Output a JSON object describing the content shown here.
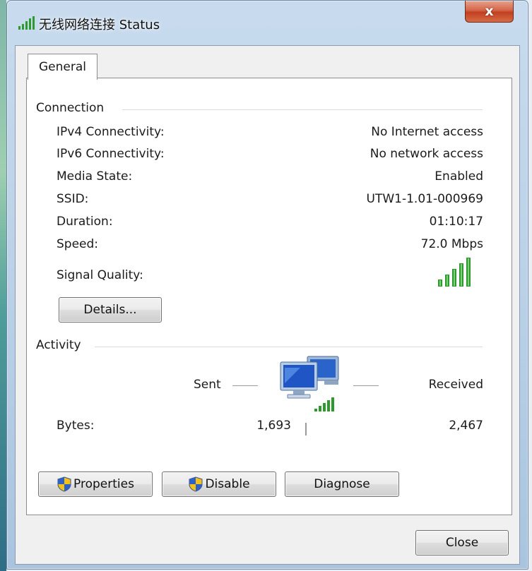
{
  "window": {
    "title": "无线网络连接 Status",
    "close_glyph": "x"
  },
  "tabs": [
    {
      "label": "General",
      "selected": true
    }
  ],
  "connection": {
    "heading": "Connection",
    "rows": [
      {
        "label": "IPv4 Connectivity:",
        "value": "No Internet access"
      },
      {
        "label": "IPv6 Connectivity:",
        "value": "No network access"
      },
      {
        "label": "Media State:",
        "value": "Enabled"
      },
      {
        "label": "SSID:",
        "value": "UTW1-1.01-000969"
      },
      {
        "label": "Duration:",
        "value": "01:10:17"
      },
      {
        "label": "Speed:",
        "value": "72.0 Mbps"
      }
    ],
    "signal_label": "Signal Quality:",
    "signal_bars": 5,
    "signal_icon": "signal-strength-icon",
    "details_button": "Details..."
  },
  "activity": {
    "heading": "Activity",
    "sent_label": "Sent",
    "received_label": "Received",
    "network_icon": "network-computers-icon",
    "bytes_label": "Bytes:",
    "bytes_sent": "1,693",
    "bytes_received": "2,467"
  },
  "buttons": {
    "properties": "Properties",
    "disable": "Disable",
    "diagnose": "Diagnose",
    "close": "Close"
  },
  "colors": {
    "signal_green": "#2e9a2e",
    "close_button_red": "#c2401f",
    "shield_blue": "#2f62c4",
    "shield_yellow": "#f3c21a"
  }
}
